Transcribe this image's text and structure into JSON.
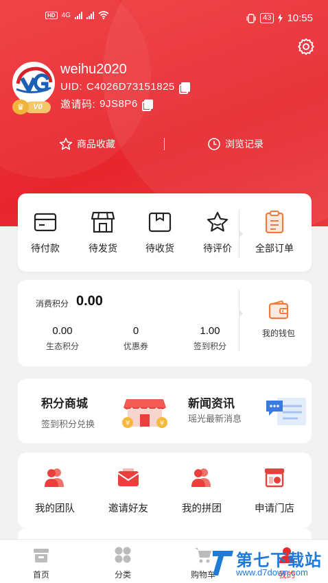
{
  "status_bar": {
    "left_badges": [
      "HD",
      "4G"
    ],
    "battery": "43",
    "time": "10:55"
  },
  "profile": {
    "username": "weihu2020",
    "uid_label": "UID:",
    "uid_value": "C4026D73151825",
    "invite_label": "邀请码:",
    "invite_value": "9JS8P6",
    "vip_level": "V0"
  },
  "quick_links": {
    "favorites": "商品收藏",
    "history": "浏览记录"
  },
  "orders": {
    "items": [
      {
        "label": "待付款",
        "icon": "wallet-card-icon"
      },
      {
        "label": "待发货",
        "icon": "shop-icon"
      },
      {
        "label": "待收货",
        "icon": "package-icon"
      },
      {
        "label": "待评价",
        "icon": "star-icon"
      }
    ],
    "all": {
      "label": "全部订单",
      "icon": "clipboard-icon"
    }
  },
  "points": {
    "consume_label": "消费积分",
    "consume_value": "0.00",
    "stats": [
      {
        "value": "0.00",
        "label": "生态积分"
      },
      {
        "value": "0",
        "label": "优惠券"
      },
      {
        "value": "1.00",
        "label": "签到积分"
      }
    ],
    "wallet_label": "我的钱包"
  },
  "promos": {
    "mall_title": "积分商城",
    "mall_sub": "签到积分兑换",
    "news_title": "新闻资讯",
    "news_sub": "瑶光最新消息"
  },
  "tools": [
    {
      "label": "我的团队",
      "icon": "team-icon"
    },
    {
      "label": "邀请好友",
      "icon": "invite-icon"
    },
    {
      "label": "我的拼团",
      "icon": "group-buy-icon"
    },
    {
      "label": "申请门店",
      "icon": "store-icon"
    }
  ],
  "tabbar": [
    {
      "label": "首页",
      "icon": "home-icon"
    },
    {
      "label": "分类",
      "icon": "category-icon"
    },
    {
      "label": "购物车",
      "icon": "cart-icon"
    },
    {
      "label": "我的",
      "icon": "profile-icon"
    }
  ],
  "watermark": {
    "text": "第七下载站",
    "url": "www.d7down.com"
  },
  "colors": {
    "brand_red": "#e7262e",
    "accent_orange": "#f07a3a",
    "watermark_blue": "#1f7ad8"
  }
}
